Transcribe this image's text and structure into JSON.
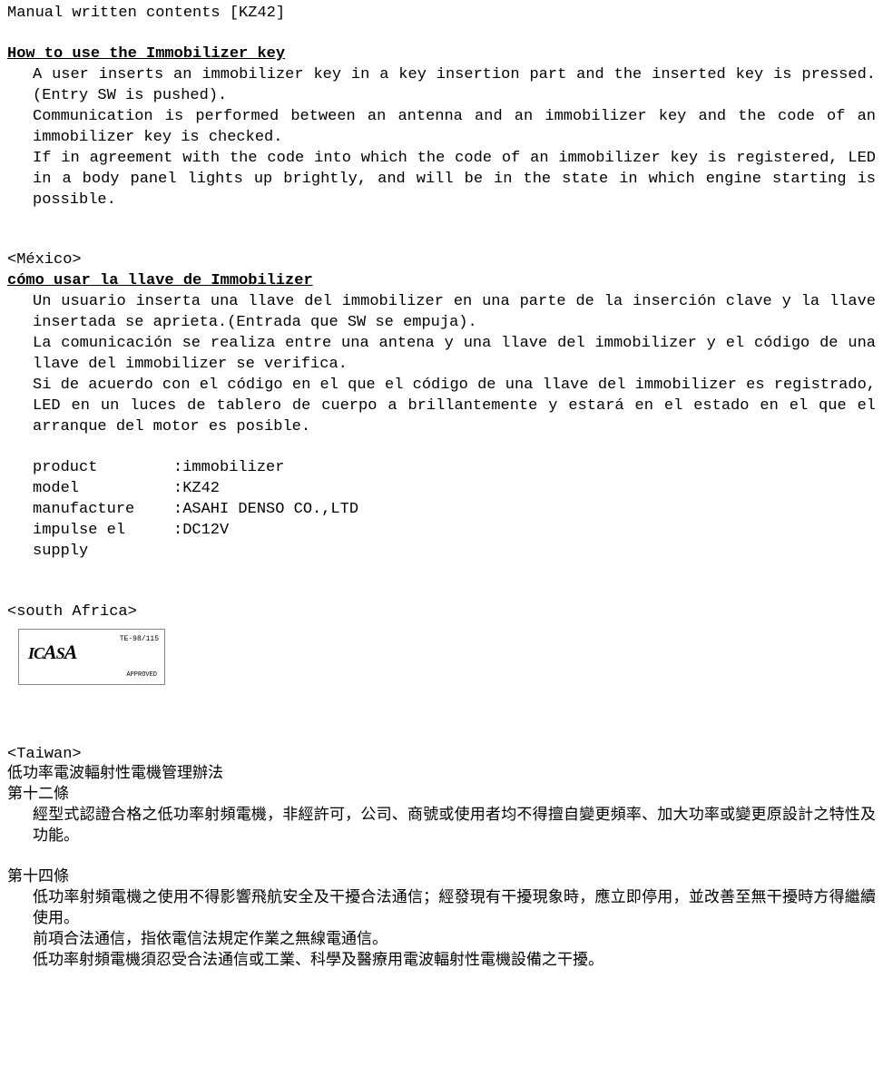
{
  "header": {
    "title": "Manual written contents [KZ42]"
  },
  "english": {
    "heading": "How to use the Immobilizer key",
    "p1": "A user inserts an immobilizer key in a key insertion part and the inserted key is pressed.(Entry SW is pushed).",
    "p2": "Communication is performed between an antenna and an immobilizer key and the code of an immobilizer key is checked.",
    "p3": "If in agreement with the code into which the code of an immobilizer key is registered, LED in a body panel lights up brightly, and will be in the state in which engine starting is possible."
  },
  "mexico": {
    "label": "<México>",
    "heading": "cómo usar la llave de Immobilizer",
    "p1": "Un usuario inserta una llave del immobilizer en una parte de la inserción clave y la llave insertada se aprieta.(Entrada que SW se empuja).",
    "p2": "La comunicación se realiza entre una antena y una llave del immobilizer y el código de una llave del immobilizer se verifica.",
    "p3": "Si de acuerdo con el código en el que el código de una llave del immobilizer es registrado, LED en un luces de tablero de cuerpo a brillantemente y estará en el estado en el que el arranque del motor es posible.",
    "specs": {
      "product_label": "product",
      "product_value": ":immobilizer",
      "model_label": "model",
      "model_value": ":KZ42",
      "manufacture_label": "manufacture",
      "manufacture_value": ":ASAHI DENSO CO.,LTD",
      "impulse_label": "impulse el supply",
      "impulse_value": ":DC12V"
    }
  },
  "south_africa": {
    "label": "<south Africa>",
    "icasa": {
      "logo_text": "ICASA",
      "ref": "TE-98/115",
      "approved": "APPROVED"
    }
  },
  "taiwan": {
    "label": "<Taiwan>",
    "title": "低功率電波輻射性電機管理辦法",
    "article12_title": "第十二條",
    "article12_body": "經型式認證合格之低功率射頻電機，非經許可，公司、商號或使用者均不得擅自變更頻率、加大功率或變更原設計之特性及功能。",
    "article14_title": "第十四條",
    "article14_p1": "低功率射頻電機之使用不得影響飛航安全及干擾合法通信；經發現有干擾現象時，應立即停用，並改善至無干擾時方得繼續使用。",
    "article14_p2": "前項合法通信，指依電信法規定作業之無線電通信。",
    "article14_p3": "低功率射頻電機須忍受合法通信或工業、科學及醫療用電波輻射性電機設備之干擾。"
  }
}
